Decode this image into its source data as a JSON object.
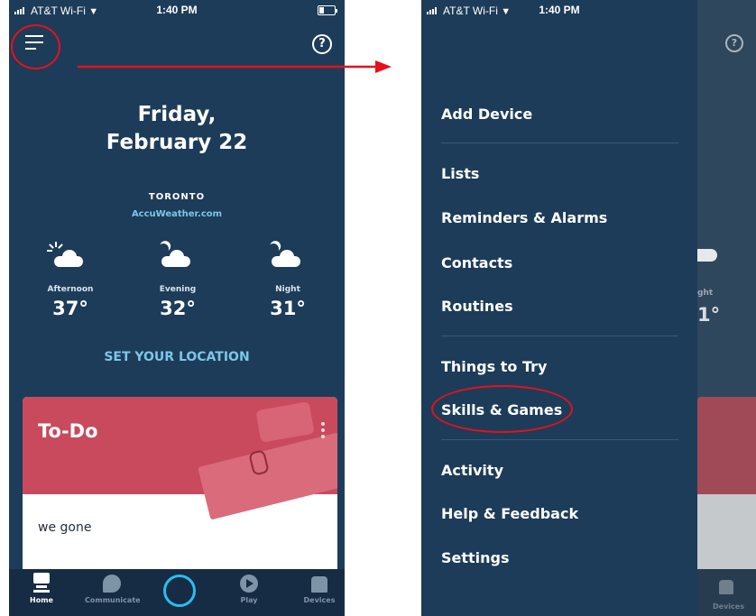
{
  "status_bar": {
    "carrier": "AT&T Wi-Fi",
    "time": "1:40 PM"
  },
  "home": {
    "day": "Friday,",
    "date": "February 22",
    "city": "TORONTO",
    "weather_source": "AccuWeather.com",
    "forecast": [
      {
        "period": "Afternoon",
        "temp": "37",
        "icon": "sun-cloud-icon"
      },
      {
        "period": "Evening",
        "temp": "32",
        "icon": "moon-cloud-icon"
      },
      {
        "period": "Night",
        "temp": "31",
        "icon": "moon-cloud-icon"
      }
    ],
    "degree_symbol": "°",
    "set_location": "SET YOUR LOCATION",
    "todo_card": {
      "title": "To-Do",
      "item": "we gone"
    }
  },
  "tab_bar": [
    {
      "label": "Home",
      "icon": "home-icon",
      "active": true
    },
    {
      "label": "Communicate",
      "icon": "chat-bubble-icon",
      "active": false
    },
    {
      "label": "",
      "icon": "alexa-ring-icon",
      "active": false
    },
    {
      "label": "Play",
      "icon": "play-icon",
      "active": false
    },
    {
      "label": "Devices",
      "icon": "devices-house-icon",
      "active": false
    }
  ],
  "drawer": {
    "items": [
      "Add Device",
      "Lists",
      "Reminders & Alarms",
      "Contacts",
      "Routines",
      "Things to Try",
      "Skills & Games",
      "Activity",
      "Help & Feedback",
      "Settings"
    ],
    "background_peek": {
      "period": "ght",
      "temp": "1",
      "tab_label": "Devices"
    }
  },
  "annotation_color": "#e8101a",
  "colors": {
    "background": "#1d3c59",
    "accent": "#7cc6e9",
    "card_header": "#c84a5c",
    "alexa_ring": "#2bbdf0"
  }
}
